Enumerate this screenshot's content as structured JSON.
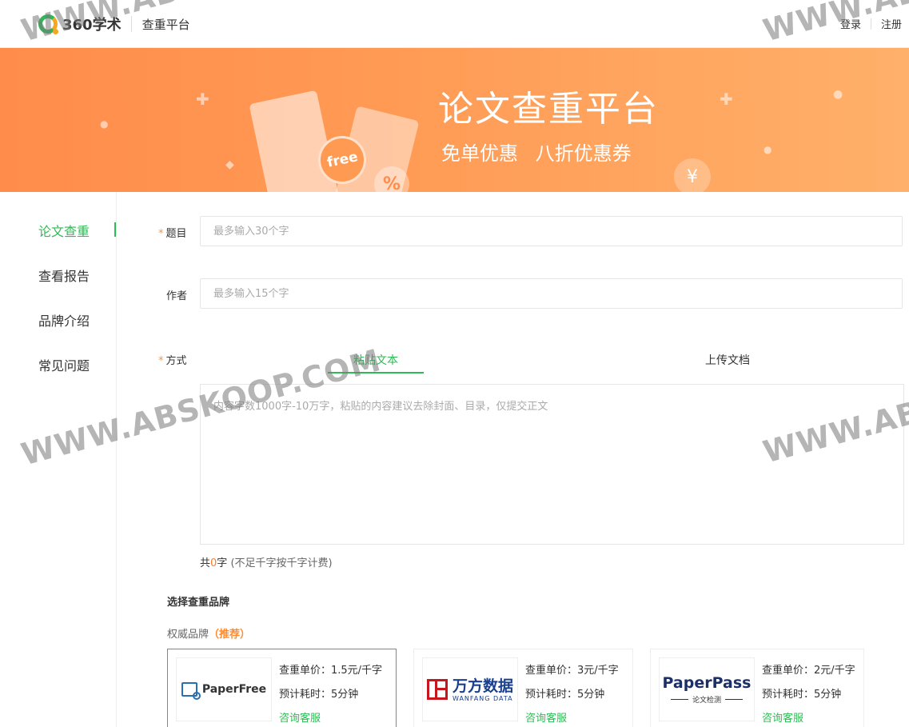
{
  "header": {
    "logo_text": "360学术",
    "platform": "查重平台",
    "login": "登录",
    "register": "注册"
  },
  "banner": {
    "title": "论文查重平台",
    "subtitle": "免单优惠  八折优惠券",
    "coin_text": "free",
    "pct": "%",
    "yen": "¥"
  },
  "sidebar": {
    "items": [
      {
        "label": "论文查重",
        "active": true
      },
      {
        "label": "查看报告",
        "active": false
      },
      {
        "label": "品牌介绍",
        "active": false
      },
      {
        "label": "常见问题",
        "active": false
      }
    ]
  },
  "form": {
    "title_label": "题目",
    "title_placeholder": "最多输入30个字",
    "author_label": "作者",
    "author_placeholder": "最多输入15个字",
    "method_label": "方式",
    "tabs": [
      {
        "label": "粘贴文本",
        "active": true
      },
      {
        "label": "上传文档",
        "active": false
      }
    ],
    "content_placeholder": "内容字数1000字-10万字，粘贴的内容建议去除封面、目录，仅提交正文",
    "count_prefix": "共",
    "count_value": "0",
    "count_suffix": "字",
    "count_note": "(不足千字按千字计费)"
  },
  "brands": {
    "section_title": "选择查重品牌",
    "group_label": "权威品牌",
    "group_tag": "（推荐）",
    "cards": [
      {
        "logo": "PaperFree",
        "price": "查重单价：1.5元/千字",
        "time": "预计耗时：5分钟",
        "service": "咨询客服",
        "selected": true
      },
      {
        "logo_cn": "万方数据",
        "logo_en": "WANFANG DATA",
        "price": "查重单价：3元/千字",
        "time": "预计耗时：5分钟",
        "service": "咨询客服",
        "selected": false
      },
      {
        "logo": "PaperPass",
        "logo_sub": "论文检测",
        "price": "查重单价：2元/千字",
        "time": "预计耗时：5分钟",
        "service": "咨询客服",
        "selected": false
      }
    ]
  },
  "watermark": "WWW.ABSKOOP.COM",
  "colors": {
    "accent": "#2dbb55",
    "banner": "#ff9350",
    "highlight": "#ff8a2f"
  }
}
